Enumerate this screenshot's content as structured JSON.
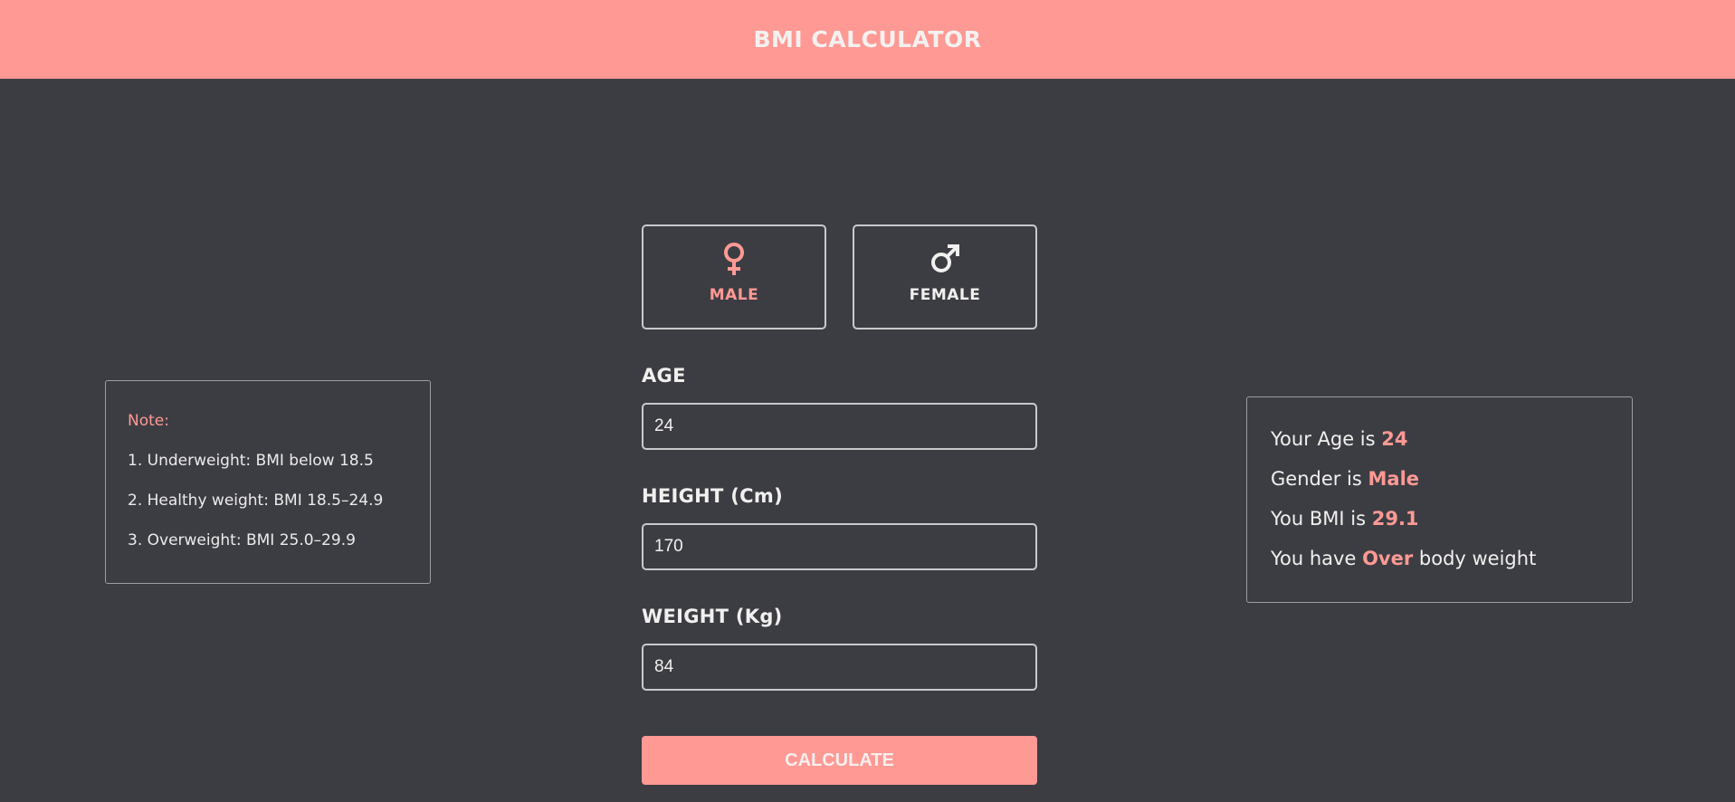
{
  "header": {
    "title": "BMI CALCULATOR"
  },
  "note": {
    "title": "Note:",
    "lines": [
      "1. Underweight: BMI below 18.5",
      "2. Healthy weight: BMI 18.5–24.9",
      "3. Overweight: BMI 25.0–29.9"
    ]
  },
  "gender": {
    "male_label": "MALE",
    "female_label": "FEMALE",
    "male_icon": "female-symbol-icon",
    "female_icon": "male-symbol-icon",
    "selected": "MALE"
  },
  "form": {
    "age_label": "AGE",
    "age_value": "24",
    "height_label": "HEIGHT (Cm)",
    "height_value": "170",
    "weight_label": "WEIGHT (Kg)",
    "weight_value": "84",
    "calculate_label": "CALCULATE"
  },
  "result": {
    "age_prefix": "Your Age is ",
    "age": "24",
    "gender_prefix": "Gender is ",
    "gender": "Male",
    "bmi_prefix": "You BMI is ",
    "bmi": "29.1",
    "weight_prefix": "You have ",
    "weight_status": "Over",
    "weight_suffix": " body weight"
  },
  "colors": {
    "accent": "#ff9994",
    "background": "#3c3d43",
    "text": "#f1f0ef",
    "border": "#c9c9cc"
  }
}
